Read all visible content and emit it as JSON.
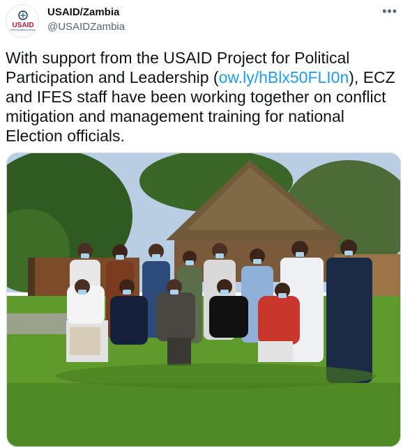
{
  "account": {
    "display_name": "USAID/Zambia",
    "handle": "@USAIDZambia",
    "avatar_logo_text": "USAID",
    "avatar_logo_subtext": "FROM THE AMERICAN PEOPLE"
  },
  "menu": {
    "more_label": "•••"
  },
  "tweet": {
    "text_before_link": "With support from the USAID Project for Political Participation and Leadership (",
    "link_text": "ow.ly/hBlx50FLI0n",
    "text_after_link": "), ECZ and IFES  staff have been working together on conflict mitigation and management training for national Election officials."
  },
  "colors": {
    "link": "#1d9bf0",
    "secondary_text": "#536471",
    "usaid_red": "#c2113a",
    "usaid_blue": "#002f6c"
  },
  "media": {
    "type": "photo",
    "icon": "group-photo"
  }
}
